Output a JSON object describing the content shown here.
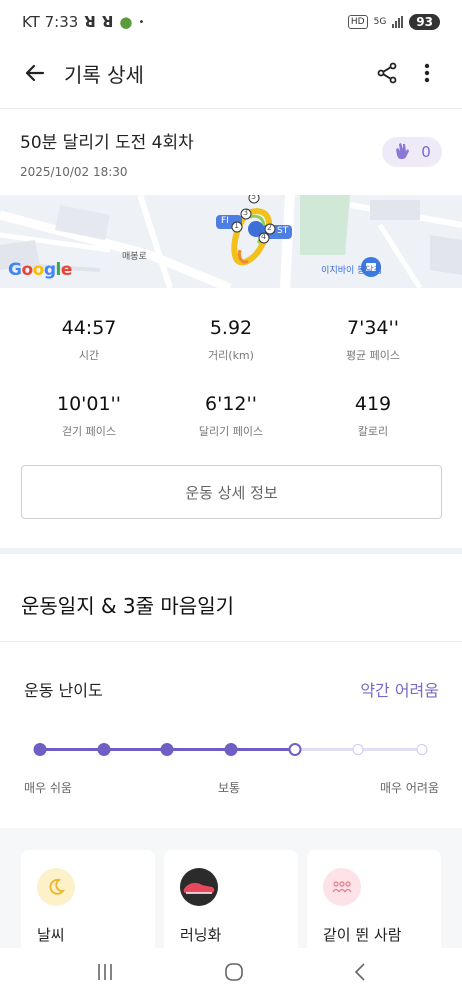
{
  "status_bar": {
    "carrier_time": "KT 7:33",
    "hd_badge": "HD",
    "network": "5G",
    "battery": "93"
  },
  "header": {
    "title": "기록 상세",
    "back_icon": "arrow-left-icon",
    "share_icon": "share-icon",
    "more_icon": "more-vertical-icon"
  },
  "record": {
    "title": "50분 달리기 도전 4회차",
    "date": "2025/10/02 18:30",
    "clap_count": "0"
  },
  "map": {
    "brand": "Google",
    "street_label": "매봉로",
    "poi_label": "이지바이 봉담점",
    "marker_start": "ST",
    "marker_finish": "FI",
    "lap_markers": [
      "1",
      "2",
      "3",
      "4",
      "5"
    ]
  },
  "stats": [
    {
      "value": "44:57",
      "label": "시간"
    },
    {
      "value": "5.92",
      "label": "거리(km)"
    },
    {
      "value": "7'34''",
      "label": "평균 페이스"
    },
    {
      "value": "10'01''",
      "label": "걷기 페이스"
    },
    {
      "value": "6'12''",
      "label": "달리기 페이스"
    },
    {
      "value": "419",
      "label": "칼로리"
    }
  ],
  "detail_button": "운동 상세 정보",
  "journal": {
    "title": "운동일지 & 3줄 마음일기",
    "difficulty_label": "운동 난이도",
    "difficulty_value": "약간 어려움",
    "difficulty_level": 5,
    "difficulty_steps": 7,
    "scale_labels": [
      "매우 쉬움",
      "보통",
      "매우 어려움"
    ]
  },
  "cards": [
    {
      "label": "날씨",
      "icon": "moon-icon"
    },
    {
      "label": "러닝화",
      "icon": "running-shoe-icon"
    },
    {
      "label": "같이 뛴 사람",
      "icon": "people-icon"
    }
  ],
  "colors": {
    "accent": "#6f5fc4",
    "accent_light": "#eeeaf8",
    "route": "#f2c11b"
  }
}
